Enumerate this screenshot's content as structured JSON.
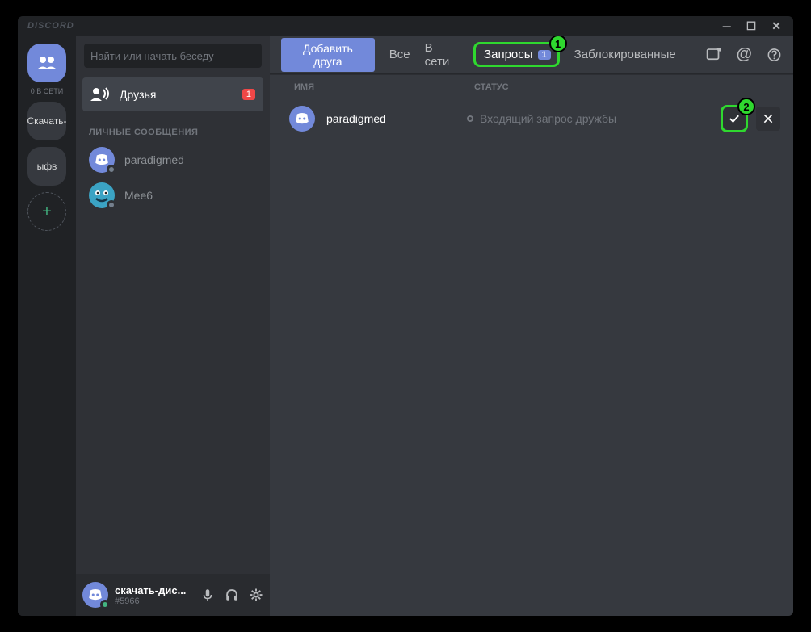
{
  "titlebar": {
    "title": "DISCORD"
  },
  "guilds": {
    "online_label": "0 В СЕТИ",
    "server1": "Скачать-",
    "server2": "ыфв",
    "add": "+"
  },
  "sidebar": {
    "search_placeholder": "Найти или начать беседу",
    "friends_label": "Друзья",
    "friends_badge": "1",
    "dm_header": "ЛИЧНЫЕ СООБЩЕНИЯ",
    "dms": [
      {
        "name": "paradigmed"
      },
      {
        "name": "Mee6"
      }
    ]
  },
  "user": {
    "name": "скачать-дис...",
    "tag": "#5966"
  },
  "header": {
    "add_friend": "Добавить друга",
    "tab_all": "Все",
    "tab_online": "В сети",
    "tab_requests": "Запросы",
    "requests_badge": "1",
    "tab_blocked": "Заблокированные"
  },
  "columns": {
    "name": "ИМЯ",
    "status": "СТАТУС"
  },
  "request": {
    "name": "paradigmed",
    "status": "Входящий запрос дружбы"
  },
  "annotations": {
    "one": "1",
    "two": "2"
  }
}
